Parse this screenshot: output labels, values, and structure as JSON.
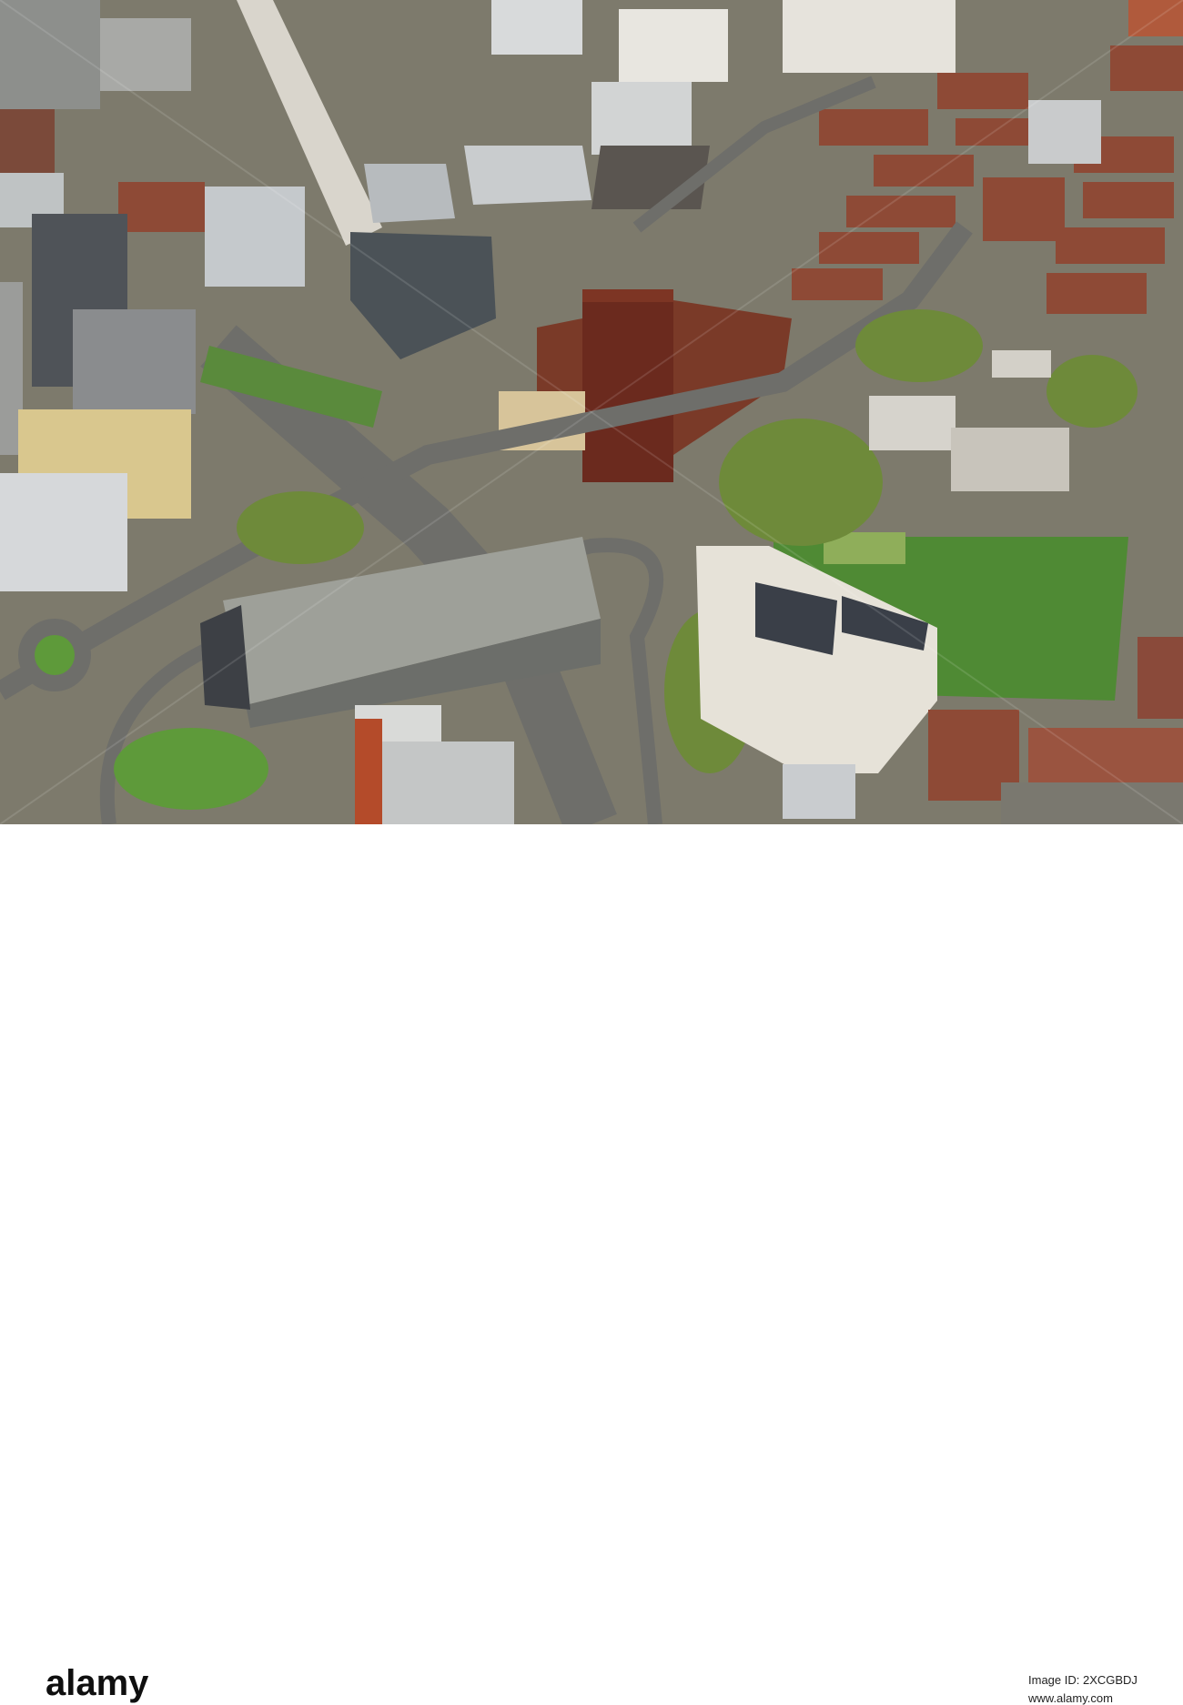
{
  "photo": {
    "subject": "aerial-city-view"
  },
  "watermark": {
    "text": "alamy"
  },
  "banner": {
    "logo": "alamy",
    "image_id": "Image ID: 2XCGBDJ",
    "url": "www.alamy.com"
  },
  "colors": {
    "brick": "#8e4a36",
    "tower": "#6b2a1e",
    "grass": "#4f8a34",
    "road": "#6e6e6a",
    "white_building": "#e6e2d8"
  }
}
